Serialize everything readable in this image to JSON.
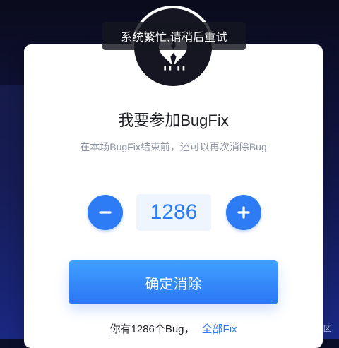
{
  "toast": {
    "text": "系统繁忙,请稍后重试"
  },
  "card": {
    "title": "我要参加BugFix",
    "subtitle": "在本场BugFix结束前，还可以再次消除Bug",
    "counter": {
      "value": "1286"
    },
    "confirm_label": "确定消除",
    "footer": {
      "prefix": "你有1286个Bug，",
      "link": "全部Fix"
    }
  },
  "watermark": "@稀土掘金技术社区",
  "colors": {
    "primary": "#2d7cf6",
    "button_gradient_top": "#3fa0ff",
    "button_gradient_bottom": "#2c76f5",
    "value_bg": "#eef5ff",
    "subtitle": "#8b92a2"
  },
  "icons": {
    "avatar": "broken-heart-icon",
    "decrement": "minus-icon",
    "increment": "plus-icon"
  }
}
